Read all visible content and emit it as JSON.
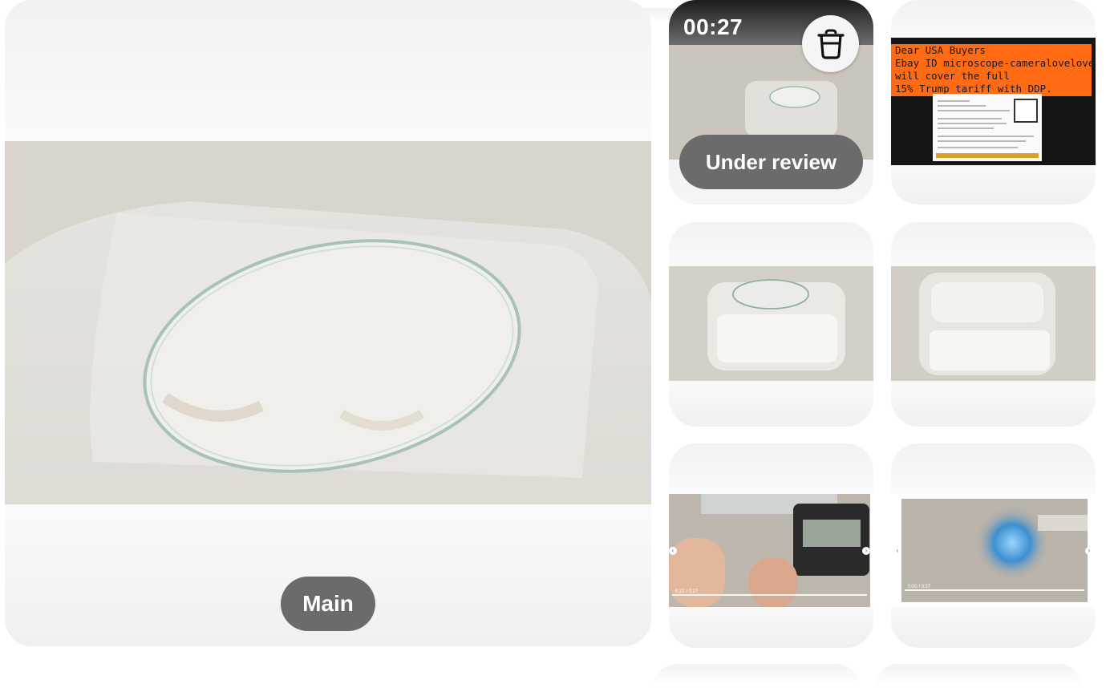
{
  "main_photo": {
    "label": "Main"
  },
  "thumbnails": {
    "video": {
      "duration": "00:27",
      "status": "Under review",
      "delete_icon": "trash-icon"
    },
    "notice_image": {
      "lines": [
        "Dear USA Buyers",
        "Ebay ID microscope-cameralovelove",
        "will cover the full",
        "15% Trump tariff with DDP."
      ]
    },
    "video_frame_1": {
      "time": "0:22 / 0:27"
    },
    "video_frame_2": {
      "time": "0:00 / 0:27"
    }
  },
  "colors": {
    "pill_bg": "#6b6b6b",
    "notice_bg": "#ff6a13",
    "card_bg": "#f5f5f5"
  }
}
